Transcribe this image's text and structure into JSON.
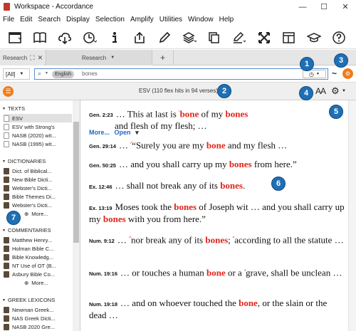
{
  "window": {
    "title": "Workspace - Accordance",
    "minimize": "—",
    "maximize": "☐",
    "close": "✕"
  },
  "menu": [
    "File",
    "Edit",
    "Search",
    "Display",
    "Selection",
    "Amplify",
    "Utilities",
    "Window",
    "Help"
  ],
  "toolbar_icons": [
    "layout-icon",
    "library-icon",
    "cloud-download-icon",
    "clock-icon",
    "info-icon",
    "export-icon",
    "pencil-icon",
    "layers-icon",
    "copy-icon",
    "highlighter-icon",
    "parallel-icon",
    "table-icon",
    "graduation-cap-icon",
    "help-icon"
  ],
  "tabs": {
    "research_label": "Research",
    "research_close": "✕",
    "main_label": "Research",
    "add": "+"
  },
  "search": {
    "scope": "[All]",
    "language": "English",
    "query": "bones"
  },
  "results": {
    "summary": "ESV (110 flex hits in 94 verses)",
    "font_size_label": "AA"
  },
  "library": {
    "texts_head": "TEXTS",
    "texts": [
      "ESV",
      "ESV with Strong's",
      "NASB (2020) wit...",
      "NASB (1995) wit..."
    ],
    "dictionaries_head": "DICTIONARIES",
    "dictionaries": [
      "Dict. of Biblical...",
      "New Bible Dicti...",
      "Webster's Dicti...",
      "Bible Themes Di...",
      "Webster's Dicti..."
    ],
    "more_label": "More...",
    "commentaries_head": "COMMENTARIES",
    "commentaries": [
      "Matthew Henry...",
      "Holman Bible C...",
      "Bible Knowledg...",
      "NT Use of OT (B...",
      "Asbury Bible Co..."
    ],
    "greek_head": "GREEK LEXICONS",
    "greek": [
      "Newman Greek...",
      "NAS Greek Dicti...",
      "NASB 2020 Gre..."
    ]
  },
  "more_open": {
    "more": "More...",
    "open": "Open",
    "caret": "▾"
  },
  "hits": [
    {
      "ref": "Gen. 2:23",
      "parts": [
        "… This at last is ",
        "ʳ",
        "bone",
        " of my ",
        "bones",
        " and flesh of my flesh; …"
      ]
    },
    {
      "ref": "Gen. 29:14",
      "parts": [
        "… ",
        "ᵖ",
        "“Surely you are my ",
        "bone",
        " and my flesh …"
      ]
    },
    {
      "ref": "Gen. 50:25",
      "parts": [
        "… and you shall carry up my ",
        "bones",
        " from here.”"
      ]
    },
    {
      "ref": "Ex. 12:46",
      "parts": [
        "… shall not break any of its ",
        "bones",
        "."
      ]
    },
    {
      "ref": "Ex. 13:19",
      "parts": [
        "Moses took the ",
        "bones",
        " of Joseph wit … and you shall carry up my ",
        "bones",
        " with you from here.”"
      ]
    },
    {
      "ref": "Num. 9:12",
      "parts": [
        "… ",
        "ᵐ",
        "nor break any of its ",
        "bones",
        "; ",
        "ⁿ",
        "according to all the statute …"
      ]
    },
    {
      "ref": "Num. 19:16",
      "parts": [
        "… or touches a human ",
        "bone",
        " or a ",
        "ᵍ",
        "grave, shall be unclean …"
      ]
    },
    {
      "ref": "Num. 19:18",
      "parts": [
        "… and on whoever touched the ",
        "bone",
        ", or the slain or the dead …"
      ]
    }
  ],
  "callouts": [
    "1",
    "2",
    "3",
    "4",
    "5",
    "6",
    "7"
  ],
  "colors": {
    "accent": "#1f6fb5",
    "highlight": "#e0241a",
    "brand": "#f07c1a"
  }
}
